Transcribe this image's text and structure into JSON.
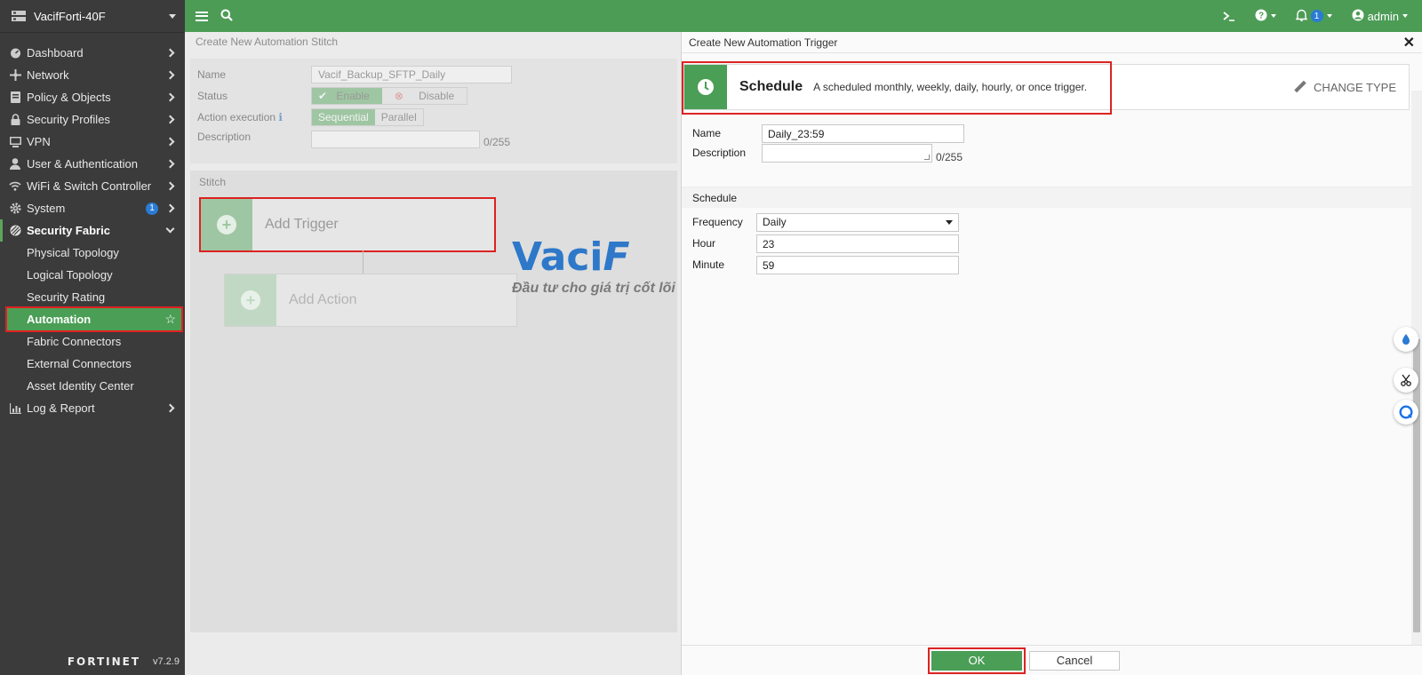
{
  "sidebar": {
    "device_name": "VacifForti-40F",
    "items": [
      {
        "label": "Dashboard",
        "icon": "dashboard-icon"
      },
      {
        "label": "Network",
        "icon": "network-icon"
      },
      {
        "label": "Policy & Objects",
        "icon": "policy-icon"
      },
      {
        "label": "Security Profiles",
        "icon": "lock-icon"
      },
      {
        "label": "VPN",
        "icon": "vpn-icon"
      },
      {
        "label": "User & Authentication",
        "icon": "user-icon"
      },
      {
        "label": "WiFi & Switch Controller",
        "icon": "wifi-icon"
      },
      {
        "label": "System",
        "icon": "gear-icon",
        "badge": "1"
      },
      {
        "label": "Security Fabric",
        "icon": "fabric-icon"
      },
      {
        "label": "Log & Report",
        "icon": "chart-icon"
      }
    ],
    "fabric_sub": [
      "Physical Topology",
      "Logical Topology",
      "Security Rating",
      "Automation",
      "Fabric Connectors",
      "External Connectors",
      "Asset Identity Center"
    ],
    "footer_logo": "FORTINET",
    "version": "v7.2.9"
  },
  "topbar": {
    "notif_count": "1",
    "user": "admin"
  },
  "stitch": {
    "title": "Create New Automation Stitch",
    "name_label": "Name",
    "name_value": "Vacif_Backup_SFTP_Daily",
    "status_label": "Status",
    "enable": "Enable",
    "disable": "Disable",
    "action_exec_label": "Action execution",
    "sequential": "Sequential",
    "parallel": "Parallel",
    "description_label": "Description",
    "desc_counter": "0/255",
    "stitch_label": "Stitch",
    "add_trigger": "Add Trigger",
    "add_action": "Add Action"
  },
  "watermark": {
    "logo_a": "Vaci",
    "logo_b": "F",
    "tagline": "Đầu tư cho giá trị cốt lõi"
  },
  "panel": {
    "title": "Create New Automation Trigger",
    "type_name": "Schedule",
    "type_desc": "A scheduled monthly, weekly, daily, hourly, or once trigger.",
    "change_type": "CHANGE TYPE",
    "name_label": "Name",
    "name_value": "Daily_23:59",
    "description_label": "Description",
    "desc_counter": "0/255",
    "section_schedule": "Schedule",
    "frequency_label": "Frequency",
    "frequency_value": "Daily",
    "hour_label": "Hour",
    "hour_value": "23",
    "minute_label": "Minute",
    "minute_value": "59",
    "ok": "OK",
    "cancel": "Cancel"
  },
  "colors": {
    "brand_green": "#4c9c56",
    "sidebar_bg": "#3b3b3b",
    "highlight_red": "#dd2222",
    "badge_blue": "#2a7bd4"
  }
}
